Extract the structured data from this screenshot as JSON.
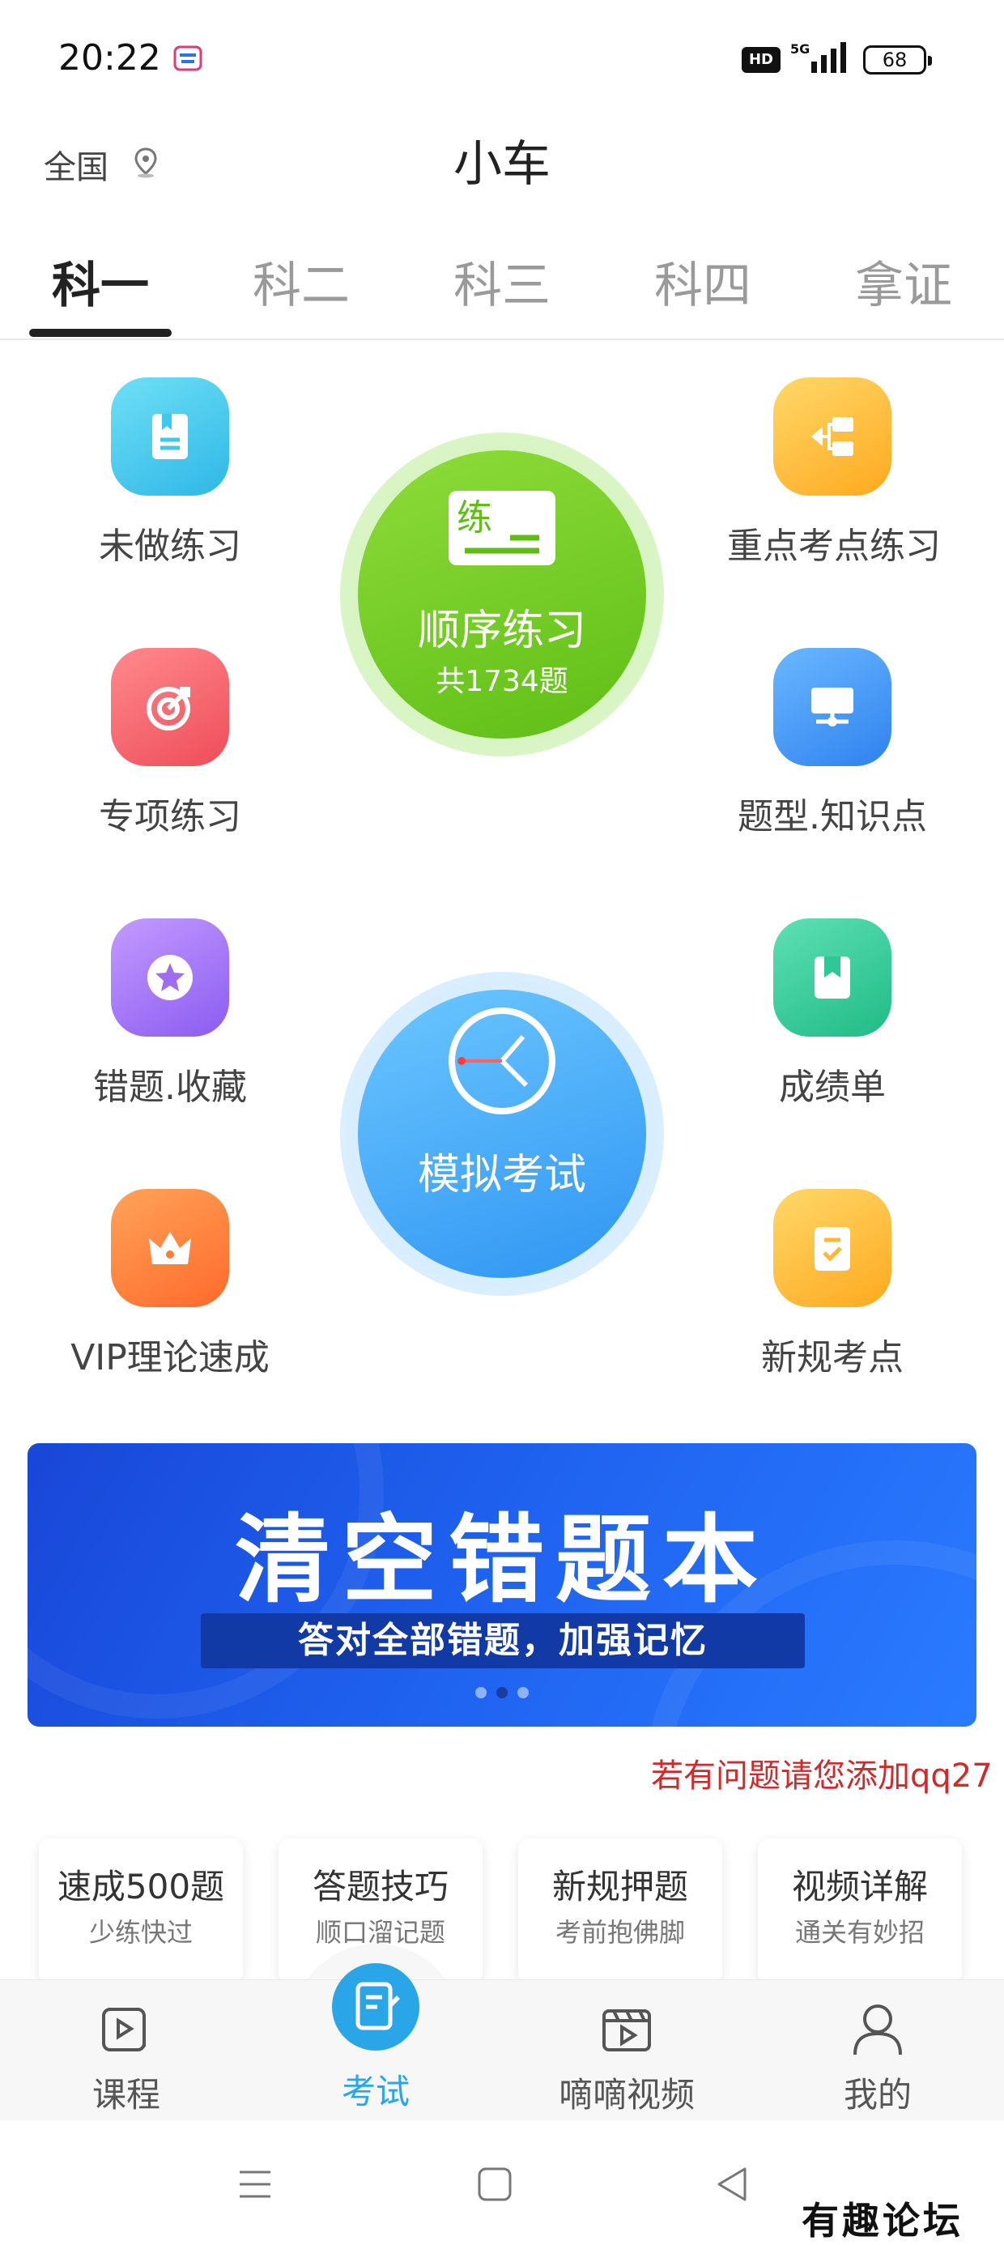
{
  "status_bar": {
    "time": "20:22",
    "network": "5G",
    "battery": "68",
    "hd_badge": "HD"
  },
  "header": {
    "location": "全国",
    "title": "小车"
  },
  "tabs": [
    {
      "label": "科一",
      "active": true
    },
    {
      "label": "科二",
      "active": false
    },
    {
      "label": "科三",
      "active": false
    },
    {
      "label": "科四",
      "active": false
    },
    {
      "label": "拿证",
      "active": false
    }
  ],
  "grid": {
    "left": [
      {
        "label": "未做练习",
        "icon": "book-icon",
        "color": "#3fc8ee"
      },
      {
        "label": "专项练习",
        "icon": "target-icon",
        "color": "#f2626a"
      },
      {
        "label": "错题.收藏",
        "icon": "star-icon",
        "color": "#a06cf0"
      },
      {
        "label": "VIP理论速成",
        "icon": "crown-icon",
        "color": "#ff7b3a"
      }
    ],
    "right": [
      {
        "label": "重点考点练习",
        "icon": "flow-icon",
        "color": "#ffb830"
      },
      {
        "label": "题型.知识点",
        "icon": "monitor-icon",
        "color": "#3a96f0"
      },
      {
        "label": "成绩单",
        "icon": "bookmark-icon",
        "color": "#2ec796"
      },
      {
        "label": "新规考点",
        "icon": "checklist-icon",
        "color": "#ffb830"
      }
    ]
  },
  "sequence_practice": {
    "badge": "练",
    "label": "顺序练习",
    "count": "共1734题"
  },
  "mock_exam": {
    "label": "模拟考试"
  },
  "banner": {
    "headline": "清空错题本",
    "subline": "答对全部错题，加强记忆"
  },
  "marquee": "若有问题请您添加qq27",
  "cards": [
    {
      "title": "速成500题",
      "subtitle": "少练快过"
    },
    {
      "title": "答题技巧",
      "subtitle": "顺口溜记题"
    },
    {
      "title": "新规押题",
      "subtitle": "考前抱佛脚"
    },
    {
      "title": "视频详解",
      "subtitle": "通关有妙招"
    }
  ],
  "bottom_nav": [
    {
      "label": "课程",
      "icon": "course-icon",
      "active": false
    },
    {
      "label": "考试",
      "icon": "exam-icon",
      "active": true
    },
    {
      "label": "嘀嘀视频",
      "icon": "video-icon",
      "active": false
    },
    {
      "label": "我的",
      "icon": "profile-icon",
      "active": false
    }
  ],
  "watermark": "有趣论坛"
}
